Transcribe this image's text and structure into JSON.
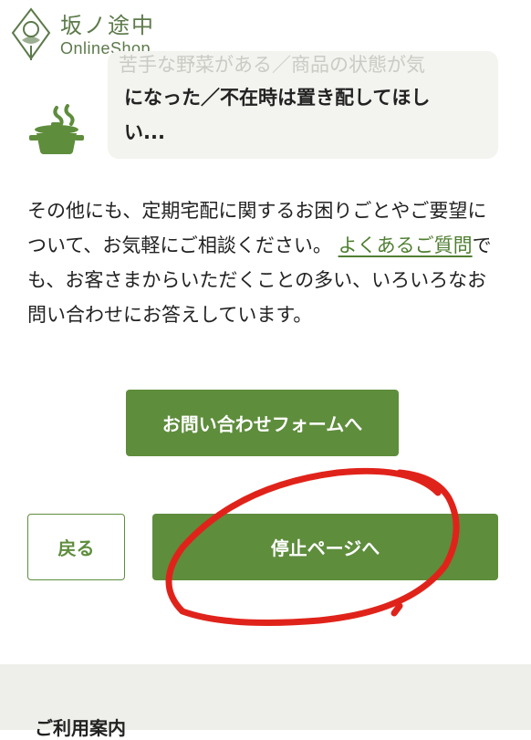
{
  "header": {
    "logo_kanji": "坂ノ途中",
    "logo_sub": "OnlineShop"
  },
  "chat": {
    "faded_line": "苦手な野菜がある／商品の状態が気",
    "bubble_line1": "になった／不在時は置き配してほし",
    "bubble_line2": "い..."
  },
  "main": {
    "paragraph_before_link": "その他にも、定期宅配に関するお困りごとやご要望について、お気軽にご相談ください。",
    "faq_link": "よくあるご質問",
    "paragraph_after_link": "でも、お客さまからいただくことの多い、いろいろなお問い合わせにお答えしています。"
  },
  "buttons": {
    "contact_form": "お問い合わせフォームへ",
    "back": "戻る",
    "stop_page": "停止ページへ"
  },
  "footer": {
    "title": "ご利用案内"
  },
  "colors": {
    "brand_green": "#5e8d3c",
    "link_green": "#4f7f32",
    "annotation_red": "#e0231a"
  }
}
